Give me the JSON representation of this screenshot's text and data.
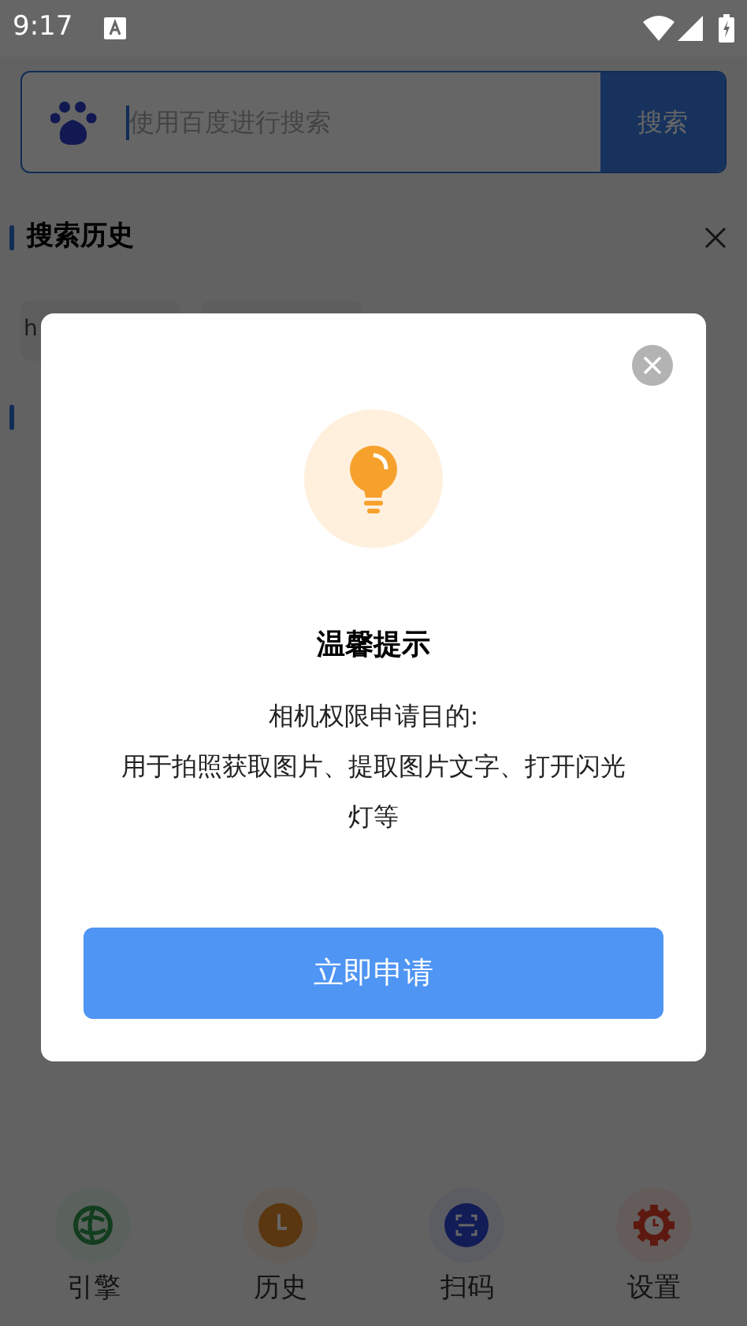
{
  "status_bar": {
    "time": "9:17"
  },
  "search": {
    "placeholder": "使用百度进行搜索",
    "button": "搜索"
  },
  "history": {
    "title": "搜索历史",
    "chips": [
      {
        "kind": "text",
        "label": "h"
      },
      {
        "kind": "blank"
      }
    ]
  },
  "dialog": {
    "title": "温馨提示",
    "lines": [
      "相机权限申请目的:",
      "用于拍照获取图片、提取图片文字、打开闪光灯等"
    ],
    "button": "立即申请"
  },
  "bottom_nav": [
    {
      "kind": "engine",
      "label": "引擎"
    },
    {
      "kind": "history",
      "label": "历史"
    },
    {
      "kind": "scan",
      "label": "扫码"
    },
    {
      "kind": "settings",
      "label": "设置"
    }
  ]
}
